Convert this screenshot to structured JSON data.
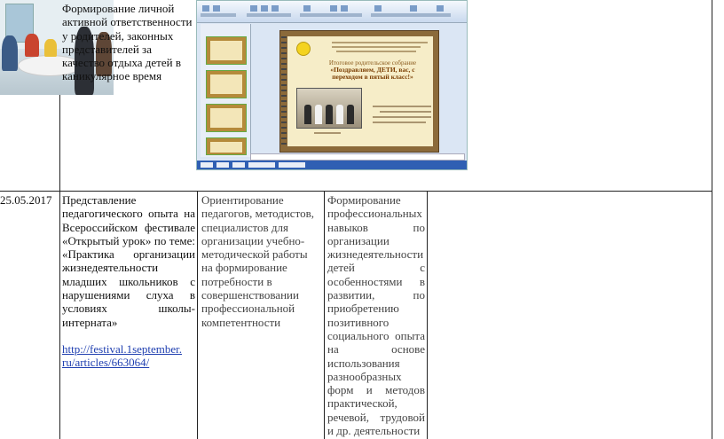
{
  "row1": {
    "description": "Формирование личной активной ответственности у родителей, законных представителей за качество отдыха детей в каникулярное время"
  },
  "row2": {
    "date": "25.05.2017",
    "event": "Представление педагогического опыта на Всероссийском фестивале «Открытый урок» по теме: «Практика организации жизнедеятельности младших школьников с нарушениями слуха в условиях школы-интерната»",
    "link": "http://festival.1september.ru/articles/663064/",
    "link_line1": "http://festival.1september.",
    "link_line2": "ru/articles/663064/",
    "goal": "Ориентирование педагогов, методистов, специалистов для организации учебно-методической работы на формирование потребности в совершенствовании профессиональной компетентности",
    "result": "Формирование профессиональных навыков по организации жизнедеятельности детей с особенностями в развитии, по приобретению позитивного социального опыта на основе использования разнообразных форм и методов практической, речевой, трудовой и др. деятельности"
  },
  "slide": {
    "title": "Итоговое родительское собрание",
    "headline": "«Поздравляем, ДЕТИ, вас, с переходом в пятый класс!»"
  }
}
